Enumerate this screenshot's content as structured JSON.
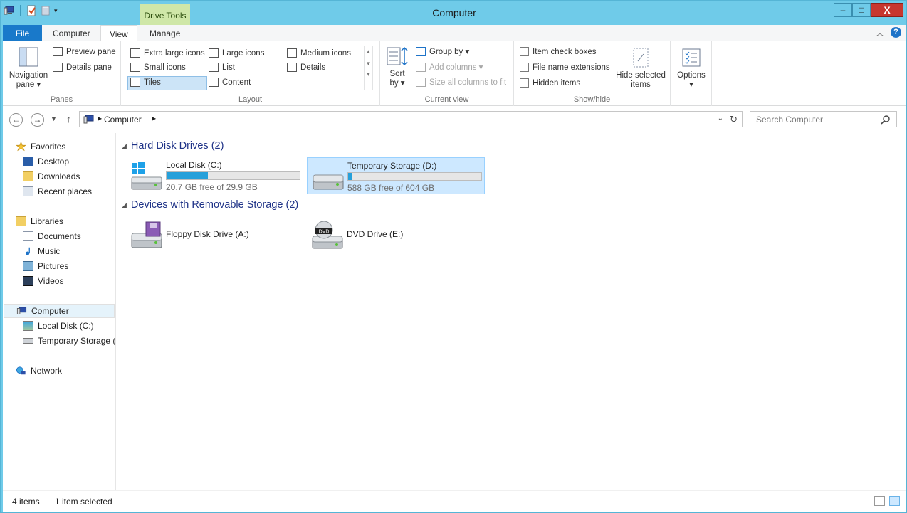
{
  "window": {
    "title": "Computer",
    "contextual_tab": "Drive Tools",
    "accent": "#6fcbe9",
    "controls": {
      "minimize": "–",
      "maximize": "□",
      "close": "X"
    }
  },
  "ribbon": {
    "tabs": [
      "File",
      "Computer",
      "View",
      "Manage"
    ],
    "active_tab": "View",
    "help": "?",
    "panes": {
      "navigation_pane": "Navigation pane ▾",
      "preview_pane": "Preview pane",
      "details_pane": "Details pane",
      "label": "Panes"
    },
    "layout": {
      "items": [
        "Extra large icons",
        "Large icons",
        "Medium icons",
        "Small icons",
        "List",
        "Details",
        "Tiles",
        "Content"
      ],
      "selected": "Tiles",
      "label": "Layout"
    },
    "current_view": {
      "sort_by": "Sort by ▾",
      "group_by": "Group by ▾",
      "add_columns": "Add columns ▾",
      "size_all_columns": "Size all columns to fit",
      "label": "Current view"
    },
    "show_hide": {
      "item_check_boxes": "Item check boxes",
      "file_name_extensions": "File name extensions",
      "hidden_items": "Hidden items",
      "hide_selected": "Hide selected items",
      "label": "Show/hide"
    },
    "options": "Options ▾"
  },
  "addressbar": {
    "crumbs": [
      "Computer"
    ],
    "search_placeholder": "Search Computer"
  },
  "navpane": {
    "favorites": {
      "label": "Favorites",
      "items": [
        "Desktop",
        "Downloads",
        "Recent places"
      ]
    },
    "libraries": {
      "label": "Libraries",
      "items": [
        "Documents",
        "Music",
        "Pictures",
        "Videos"
      ]
    },
    "computer": {
      "label": "Computer",
      "items": [
        "Local Disk (C:)",
        "Temporary Storage (D:)"
      ]
    },
    "network": {
      "label": "Network"
    }
  },
  "content": {
    "groups": [
      {
        "title": "Hard Disk Drives (2)",
        "items": [
          {
            "name": "Local Disk (C:)",
            "free": "20.7 GB free of 29.9 GB",
            "used_fraction": 0.31,
            "selected": false
          },
          {
            "name": "Temporary Storage (D:)",
            "free": "588 GB free of 604 GB",
            "used_fraction": 0.03,
            "selected": true
          }
        ]
      },
      {
        "title": "Devices with Removable Storage (2)",
        "items": [
          {
            "name": "Floppy Disk Drive (A:)"
          },
          {
            "name": "DVD Drive (E:)",
            "badge": "DVD"
          }
        ]
      }
    ]
  },
  "status": {
    "items": "4 items",
    "selected": "1 item selected"
  }
}
